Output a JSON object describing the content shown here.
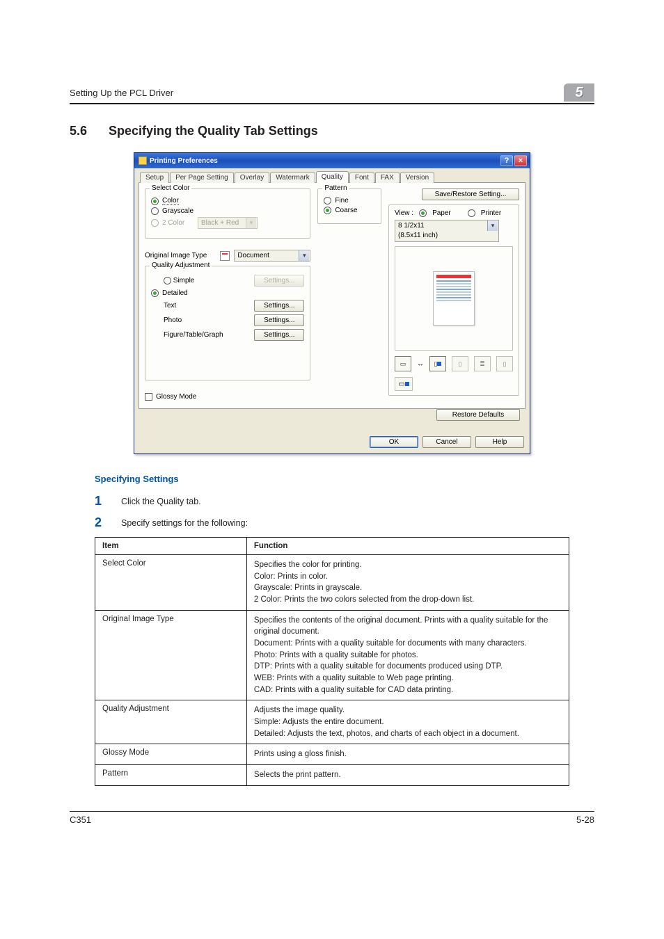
{
  "header": {
    "title": "Setting Up the PCL Driver",
    "chapterNum": "5"
  },
  "section": {
    "num": "5.6",
    "title": "Specifying the Quality Tab Settings"
  },
  "dialog": {
    "title": "Printing Preferences",
    "helpGlyph": "?",
    "closeGlyph": "×",
    "tabs": [
      "Setup",
      "Per Page Setting",
      "Overlay",
      "Watermark",
      "Quality",
      "Font",
      "FAX",
      "Version"
    ],
    "activeTab": "Quality",
    "selectColor": {
      "group": "Select Color",
      "color": "Color",
      "grayscale": "Grayscale",
      "twoColor": "2 Color",
      "twoColorValue": "Black + Red"
    },
    "origImg": {
      "label": "Original Image Type",
      "value": "Document"
    },
    "quality": {
      "group": "Quality Adjustment",
      "simple": "Simple",
      "detailed": "Detailed",
      "rows": {
        "text": "Text",
        "photo": "Photo",
        "figure": "Figure/Table/Graph"
      },
      "settingsBtn": "Settings..."
    },
    "glossy": "Glossy Mode",
    "pattern": {
      "group": "Pattern",
      "fine": "Fine",
      "coarse": "Coarse"
    },
    "saveRestore": "Save/Restore Setting...",
    "view": {
      "label": "View :",
      "paper": "Paper",
      "printer": "Printer"
    },
    "paperSize": "8 1/2x11\n(8.5x11 inch)",
    "restore": "Restore Defaults",
    "buttons": {
      "ok": "OK",
      "cancel": "Cancel",
      "help": "Help"
    }
  },
  "spec": {
    "heading": "Specifying Settings",
    "step1": "Click the Quality tab.",
    "step2": "Specify settings for the following:"
  },
  "table": {
    "h1": "Item",
    "h2": "Function",
    "rows": [
      {
        "item": "Select Color",
        "fn": "Specifies the color for printing.\nColor: Prints in color.\nGrayscale: Prints in grayscale.\n2 Color: Prints the two colors selected from the drop-down list."
      },
      {
        "item": "Original Image Type",
        "fn": "Specifies the contents of the original document. Prints with a quality suitable for the original document.\nDocument: Prints with a quality suitable for documents with many characters.\nPhoto: Prints with a quality suitable for photos.\nDTP: Prints with a quality suitable for documents produced using DTP.\nWEB: Prints with a quality suitable to Web page printing.\nCAD: Prints with a quality suitable for CAD data printing."
      },
      {
        "item": "Quality Adjustment",
        "fn": "Adjusts the image quality.\nSimple: Adjusts the entire document.\nDetailed: Adjusts the text, photos, and charts of each object in a document."
      },
      {
        "item": "Glossy Mode",
        "fn": "Prints using a gloss finish."
      },
      {
        "item": "Pattern",
        "fn": "Selects the print pattern."
      }
    ]
  },
  "footer": {
    "left": "C351",
    "right": "5-28"
  }
}
